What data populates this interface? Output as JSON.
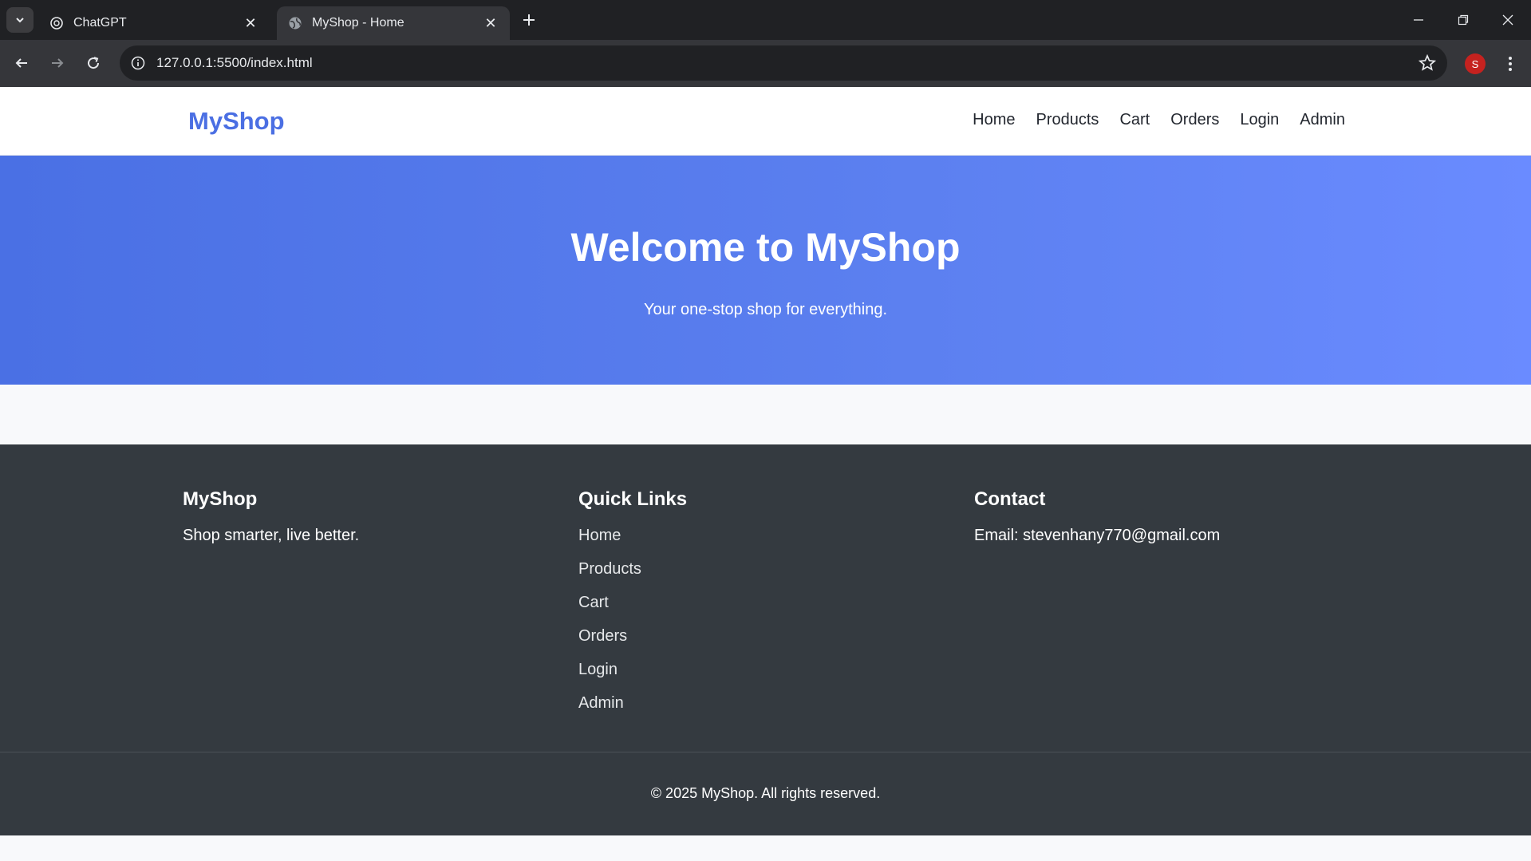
{
  "browser": {
    "tabs": [
      {
        "title": "ChatGPT",
        "icon": "chatgpt-icon",
        "active": false
      },
      {
        "title": "MyShop - Home",
        "icon": "globe-icon",
        "active": true
      }
    ],
    "url": "127.0.0.1:5500/index.html",
    "profile_initial": "S",
    "profile_color": "#c5221f"
  },
  "site": {
    "logo": "MyShop",
    "nav": [
      "Home",
      "Products",
      "Cart",
      "Orders",
      "Login",
      "Admin"
    ],
    "accent_color": "#4b6fe3"
  },
  "hero": {
    "title": "Welcome to MyShop",
    "subtitle": "Your one-stop shop for everything."
  },
  "footer": {
    "brand": {
      "title": "MyShop",
      "tagline": "Shop smarter, live better."
    },
    "quick_links": {
      "title": "Quick Links",
      "items": [
        "Home",
        "Products",
        "Cart",
        "Orders",
        "Login",
        "Admin"
      ]
    },
    "contact": {
      "title": "Contact",
      "email": "Email: stevenhany770@gmail.com"
    },
    "copyright": "© 2025 MyShop. All rights reserved."
  }
}
